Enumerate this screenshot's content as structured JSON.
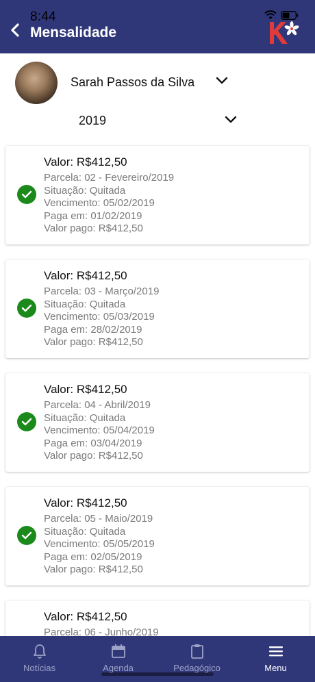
{
  "status_bar": {
    "time": "8:44"
  },
  "header": {
    "title": "Mensalidade"
  },
  "student": {
    "name": "Sarah Passos da Silva"
  },
  "year": {
    "selected": "2019"
  },
  "payments": [
    {
      "valor": "Valor: R$412,50",
      "parcela": "Parcela: 02 - Fevereiro/2019",
      "situacao": "Situação: Quitada",
      "vencimento": "Vencimento: 05/02/2019",
      "paga_em": "Paga em: 01/02/2019",
      "valor_pago": "Valor pago: R$412,50"
    },
    {
      "valor": "Valor: R$412,50",
      "parcela": "Parcela: 03 - Março/2019",
      "situacao": "Situação: Quitada",
      "vencimento": "Vencimento: 05/03/2019",
      "paga_em": "Paga em: 28/02/2019",
      "valor_pago": "Valor pago: R$412,50"
    },
    {
      "valor": "Valor: R$412,50",
      "parcela": "Parcela: 04 - Abril/2019",
      "situacao": "Situação: Quitada",
      "vencimento": "Vencimento: 05/04/2019",
      "paga_em": "Paga em: 03/04/2019",
      "valor_pago": "Valor pago: R$412,50"
    },
    {
      "valor": "Valor: R$412,50",
      "parcela": "Parcela: 05 - Maio/2019",
      "situacao": "Situação: Quitada",
      "vencimento": "Vencimento: 05/05/2019",
      "paga_em": "Paga em: 02/05/2019",
      "valor_pago": "Valor pago: R$412,50"
    },
    {
      "valor": "Valor: R$412,50",
      "parcela": "Parcela: 06 - Junho/2019",
      "situacao": "",
      "vencimento": "",
      "paga_em": "",
      "valor_pago": ""
    }
  ],
  "tabs": [
    {
      "label": "Notícias",
      "icon": "bell-icon",
      "active": false
    },
    {
      "label": "Agenda",
      "icon": "calendar-icon",
      "active": false
    },
    {
      "label": "Pedagógico",
      "icon": "clipboard-icon",
      "active": false
    },
    {
      "label": "Menu",
      "icon": "menu-icon",
      "active": true
    }
  ],
  "colors": {
    "header_bg": "#303778",
    "check_green": "#1b8a1b",
    "logo_red": "#e03a3a"
  }
}
